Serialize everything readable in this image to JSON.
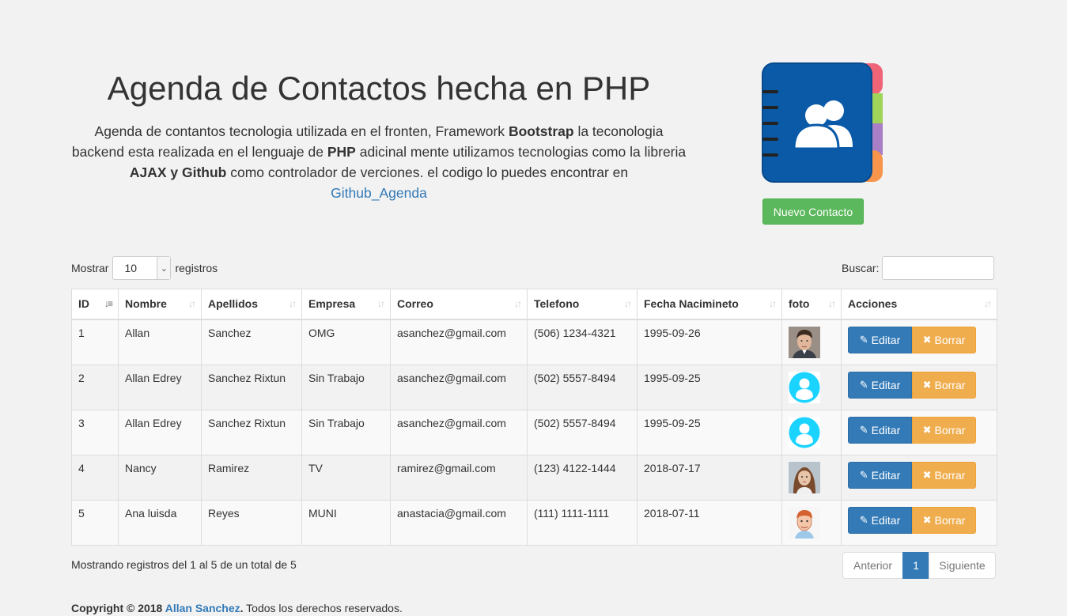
{
  "hero": {
    "title": "Agenda de Contactos hecha en PHP",
    "desc_1": "Agenda de contantos tecnologia utilizada en el fronten, Framework ",
    "desc_b1": "Bootstrap",
    "desc_2": " la teconologia backend esta realizada en el lenguaje de ",
    "desc_b2": "PHP",
    "desc_3": " adicinal mente utilizamos tecnologias como la libreria ",
    "desc_b3": "AJAX y Github",
    "desc_4": " como controlador de verciones. el codigo lo puedes encontrar en",
    "link": "Github_Agenda"
  },
  "new_contact_label": "Nuevo Contacto",
  "length": {
    "prefix": "Mostrar",
    "value": "10",
    "suffix": "registros"
  },
  "search": {
    "label": "Buscar:",
    "value": ""
  },
  "columns": [
    "ID",
    "Nombre",
    "Apellidos",
    "Empresa",
    "Correo",
    "Telefono",
    "Fecha Nacimineto",
    "foto",
    "Acciones"
  ],
  "rows": [
    {
      "id": "1",
      "nombre": "Allan",
      "apellidos": "Sanchez",
      "empresa": "OMG",
      "correo": "asanchez@gmail.com",
      "telefono": "(506) 1234-4321",
      "fecha": "1995-09-26",
      "foto": "man-photo"
    },
    {
      "id": "2",
      "nombre": "Allan Edrey",
      "apellidos": "Sanchez Rixtun",
      "empresa": "Sin Trabajo",
      "correo": "asanchez@gmail.com",
      "telefono": "(502) 5557-8494",
      "fecha": "1995-09-25",
      "foto": "default-avatar"
    },
    {
      "id": "3",
      "nombre": "Allan Edrey",
      "apellidos": "Sanchez Rixtun",
      "empresa": "Sin Trabajo",
      "correo": "asanchez@gmail.com",
      "telefono": "(502) 5557-8494",
      "fecha": "1995-09-25",
      "foto": "default-avatar"
    },
    {
      "id": "4",
      "nombre": "Nancy",
      "apellidos": "Ramirez",
      "empresa": "TV",
      "correo": "ramirez@gmail.com",
      "telefono": "(123) 4122-1444",
      "fecha": "2018-07-17",
      "foto": "woman-photo"
    },
    {
      "id": "5",
      "nombre": "Ana luisda",
      "apellidos": "Reyes",
      "empresa": "MUNI",
      "correo": "anastacia@gmail.com",
      "telefono": "(111) 1111-1111",
      "fecha": "2018-07-11",
      "foto": "cartoon-photo"
    }
  ],
  "actions": {
    "edit": "Editar",
    "delete": "Borrar"
  },
  "info": "Mostrando registros del 1 al 5 de un total de 5",
  "pager": {
    "prev": "Anterior",
    "current": "1",
    "next": "Siguiente"
  },
  "footer": {
    "prefix": "Copyright © 2018 ",
    "author": "Allan Sanchez",
    "suffix": ". Todos los derechos reservados."
  },
  "colors": {
    "primary": "#337ab7",
    "success": "#5cb85c",
    "warning": "#f0ad4e",
    "avatar": "#1ad3ff"
  }
}
